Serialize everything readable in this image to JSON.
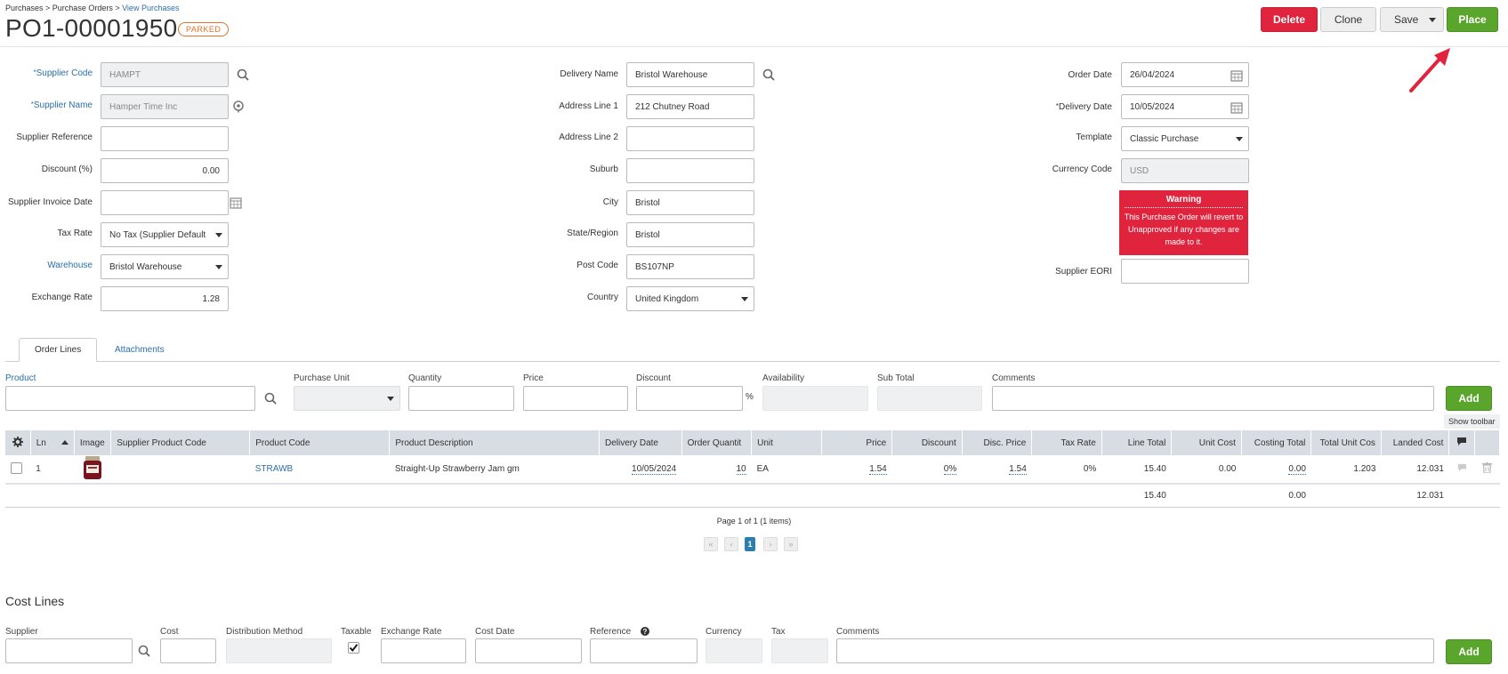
{
  "breadcrumb": {
    "part1": "Purchases",
    "sep1": " > ",
    "part2": "Purchase Orders",
    "sep2": " > ",
    "part3": "View Purchases"
  },
  "header": {
    "title": "PO1-00001950",
    "status": "PARKED"
  },
  "actions": {
    "delete": "Delete",
    "clone": "Clone",
    "save": "Save",
    "place": "Place"
  },
  "supplier": {
    "code_label": "Supplier Code",
    "code_value": "HAMPT",
    "name_label": "Supplier Name",
    "name_value": "Hamper Time Inc",
    "reference_label": "Supplier Reference",
    "reference_value": "",
    "discount_label": "Discount (%)",
    "discount_value": "0.00",
    "invoice_date_label": "Supplier Invoice Date",
    "invoice_date_value": "",
    "tax_rate_label": "Tax Rate",
    "tax_rate_value": "No Tax (Supplier Default",
    "warehouse_label": "Warehouse",
    "warehouse_value": "Bristol Warehouse",
    "exchange_rate_label": "Exchange Rate",
    "exchange_rate_value": "1.28"
  },
  "delivery": {
    "name_label": "Delivery Name",
    "name_value": "Bristol Warehouse",
    "address1_label": "Address Line 1",
    "address1_value": "212 Chutney Road",
    "address2_label": "Address Line 2",
    "address2_value": "",
    "suburb_label": "Suburb",
    "suburb_value": "",
    "city_label": "City",
    "city_value": "Bristol",
    "state_label": "State/Region",
    "state_value": "Bristol",
    "postcode_label": "Post Code",
    "postcode_value": "BS107NP",
    "country_label": "Country",
    "country_value": "United Kingdom"
  },
  "order": {
    "order_date_label": "Order Date",
    "order_date_value": "26/04/2024",
    "delivery_date_label": "Delivery Date",
    "delivery_date_value": "10/05/2024",
    "template_label": "Template",
    "template_value": "Classic Purchase",
    "currency_label": "Currency Code",
    "currency_value": "USD",
    "eori_label": "Supplier EORI",
    "eori_value": ""
  },
  "warning": {
    "title": "Warning",
    "message": "This Purchase Order will revert to Unapproved if any changes are made to it."
  },
  "tabs": [
    {
      "label": "Order Lines"
    },
    {
      "label": "Attachments"
    }
  ],
  "add_line": {
    "product": "Product",
    "purchase_unit": "Purchase Unit",
    "quantity": "Quantity",
    "price": "Price",
    "discount": "Discount",
    "percent": "%",
    "availability": "Availability",
    "sub_total": "Sub Total",
    "comments": "Comments",
    "add": "Add"
  },
  "show_toolbar": "Show toolbar",
  "grid": {
    "columns": [
      "Ln",
      "Image",
      "Supplier Product Code",
      "Product Code",
      "Product Description",
      "Delivery Date",
      "Order Quantit",
      "Unit",
      "Price",
      "Discount",
      "Disc. Price",
      "Tax Rate",
      "Line Total",
      "Unit Cost",
      "Costing Total",
      "Total Unit Cos",
      "Landed Cost"
    ],
    "rows": [
      {
        "ln": "1",
        "supplier_code": "",
        "product_code": "STRAWB",
        "description": "Straight-Up Strawberry Jam gm",
        "delivery_date": "10/05/2024",
        "qty": "10",
        "unit": "EA",
        "price": "1.54",
        "discount": "0%",
        "disc_price": "1.54",
        "tax_rate": "0%",
        "line_total": "15.40",
        "unit_cost": "0.00",
        "costing_total": "0.00",
        "total_unit_cost": "1.203",
        "landed_cost": "12.031"
      }
    ],
    "totals": {
      "line_total": "15.40",
      "costing_total": "0.00",
      "landed_cost": "12.031"
    }
  },
  "pager": {
    "text": "Page 1 of 1 (1 items)",
    "current": "1"
  },
  "cost_lines": {
    "title": "Cost Lines",
    "supplier": "Supplier",
    "cost": "Cost",
    "distribution": "Distribution Method",
    "taxable": "Taxable",
    "exchange_rate": "Exchange Rate",
    "cost_date": "Cost Date",
    "reference": "Reference",
    "currency": "Currency",
    "tax": "Tax",
    "comments": "Comments",
    "add": "Add"
  }
}
